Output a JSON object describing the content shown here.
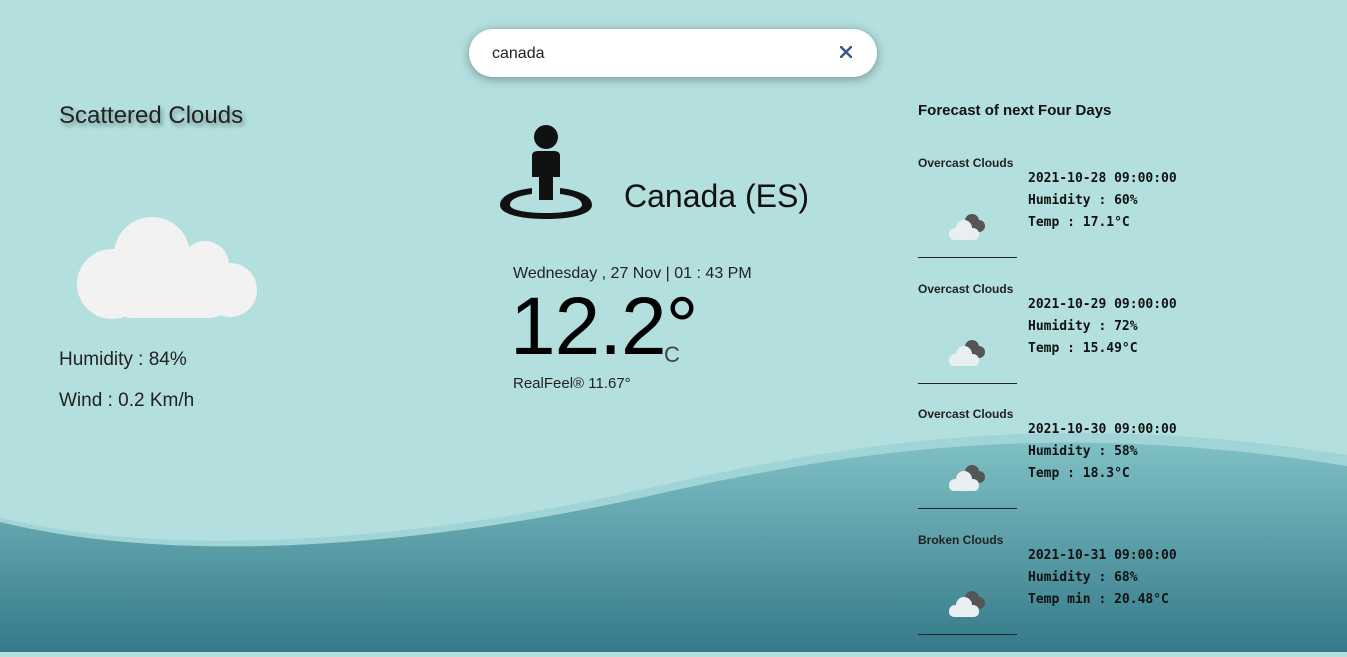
{
  "search": {
    "value": "canada",
    "clear_icon": "close-icon"
  },
  "current": {
    "condition": "Scattered Clouds",
    "humidity": "Humidity : 84%",
    "wind": "Wind : 0.2 Km/h",
    "city": "Canada (ES)",
    "datetime": "Wednesday , 27 Nov | 01 : 43 PM",
    "temperature": "12.2°",
    "unit": "C",
    "realfeel": "RealFeel® 11.67°",
    "icon": "cloud-icon",
    "location_icon": "person-pin-icon"
  },
  "forecast": {
    "title": "Forecast of next Four Days",
    "items": [
      {
        "desc": "Overcast Clouds",
        "date": "2021-10-28 09:00:00",
        "humidity": "Humidity : 60%",
        "temp": "Temp : 17.1°C"
      },
      {
        "desc": "Overcast Clouds",
        "date": "2021-10-29 09:00:00",
        "humidity": "Humidity : 72%",
        "temp": "Temp : 15.49°C"
      },
      {
        "desc": "Overcast Clouds",
        "date": "2021-10-30 09:00:00",
        "humidity": "Humidity : 58%",
        "temp": "Temp : 18.3°C"
      },
      {
        "desc": "Broken Clouds",
        "date": "2021-10-31 09:00:00",
        "humidity": "Humidity : 68%",
        "temp": "Temp min : 20.48°C"
      }
    ]
  },
  "colors": {
    "background": "#b3dfdf",
    "wave_top": "#7fc0c4",
    "wave_bottom": "#357a8a",
    "cloud": "#f2f2f2"
  }
}
